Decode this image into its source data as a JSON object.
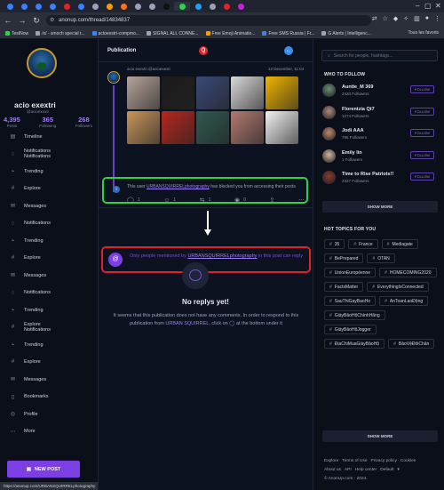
{
  "browser": {
    "url": "anonup.com/thread/14834837",
    "status_url": "https://anonup.com/URBANSQUIRRELphotography",
    "bookmarks": [
      "TestNow",
      "/x/ - smoch special t...",
      "actoexstri-compmo...",
      "SIGNAL ALL CONNE...",
      "Free Emoji Animatio...",
      "Free SMS Russia | Fr...",
      "G Alerts | Intelligenc..."
    ],
    "all_bookmarks": "Tous les favoris",
    "tab_colors": [
      "#3b82f6",
      "#3b82f6",
      "#3b82f6",
      "#3b82f6",
      "#e0222b",
      "#3b82f6",
      "#9aa3b5",
      "#f59e0b",
      "#f97316",
      "#9aa3b5",
      "#9aa3b5",
      "#111111",
      "#2fd04a",
      "#1da1f2",
      "#9aa3b5",
      "#e0222b",
      "#c026d3"
    ]
  },
  "profile": {
    "name": "acio exextri",
    "handle": "@acioexexti",
    "stats": [
      {
        "value": "4,395",
        "label": "Posts"
      },
      {
        "value": "365",
        "label": "Following"
      },
      {
        "value": "268",
        "label": "Followers"
      }
    ]
  },
  "menu": [
    {
      "icon": "timeline-icon",
      "glyph": "▤",
      "label": "Timeline"
    },
    {
      "icon": "notifications-icon",
      "glyph": "♢",
      "label": "Notifications",
      "label2": "Notifications"
    },
    {
      "icon": "trending-icon",
      "glyph": "⌁",
      "label": "Trending"
    },
    {
      "icon": "explore-icon",
      "glyph": "#",
      "label": "Explore"
    },
    {
      "icon": "messages-icon",
      "glyph": "✉",
      "label": "Messages"
    },
    {
      "icon": "notifications-icon",
      "glyph": "♢",
      "label": "Notifications"
    },
    {
      "icon": "trending-icon",
      "glyph": "⌁",
      "label": "Trending"
    },
    {
      "icon": "explore-icon",
      "glyph": "#",
      "label": "Explore"
    },
    {
      "icon": "messages-icon",
      "glyph": "✉",
      "label": "Messages"
    },
    {
      "icon": "notifications-icon",
      "glyph": "♢",
      "label": "Notifications"
    },
    {
      "icon": "trending-icon",
      "glyph": "⌁",
      "label": "Trending"
    },
    {
      "icon": "explore-icon",
      "glyph": "#",
      "label": "Explore",
      "label2": "Notifications"
    },
    {
      "icon": "trending-icon",
      "glyph": "⌁",
      "label": "Trending"
    },
    {
      "icon": "explore-icon",
      "glyph": "#",
      "label": "Explore"
    },
    {
      "icon": "messages-icon",
      "glyph": "✉",
      "label": "Messages"
    },
    {
      "icon": "bookmarks-icon",
      "glyph": "▯",
      "label": "Bookmarks"
    },
    {
      "icon": "profile-icon",
      "glyph": "◎",
      "label": "Profile"
    },
    {
      "icon": "more-icon",
      "glyph": "⋯",
      "label": "More"
    }
  ],
  "new_post_label": "NEW POST",
  "center": {
    "title": "Publication",
    "post": {
      "author": "acio exextri @acioexexti",
      "date": "12 December, 11:04",
      "actions": [
        {
          "icon": "comment-icon",
          "glyph": "◯",
          "count": "1"
        },
        {
          "icon": "like-icon",
          "glyph": "☺",
          "count": "1"
        },
        {
          "icon": "repost-icon",
          "glyph": "⇆",
          "count": "1"
        },
        {
          "icon": "views-icon",
          "glyph": "◉",
          "count": "0"
        },
        {
          "icon": "share-icon",
          "glyph": "⇪",
          "count": ""
        },
        {
          "icon": "more-icon",
          "glyph": "⋯",
          "count": ""
        }
      ],
      "thumb_colors": [
        "#b7a49a",
        "#1b1b1b",
        "#3a4a78",
        "#d9d9d9",
        "#f0b400",
        "#c9955c",
        "#b7261f",
        "#2f5a50",
        "#b07a70",
        "#f2f2f2"
      ]
    },
    "blocked": {
      "prefix": "This user ",
      "user": "URBANSQUIRRELphotography",
      "suffix": " has blocked you from accessing their posts"
    },
    "reply_only": {
      "prefix": "Only people mentioned by ",
      "user": "URBANSQUIRRELphotography",
      "suffix": " in this post can reply"
    },
    "empty": {
      "title": "No replys yet!",
      "text_a": "It seems that this publication does not have any comments. In order to respond to this publication from ",
      "user": "URBAN SQUIRREL",
      "text_b": ", click on ",
      "text_c": " at the bottom under it"
    }
  },
  "right": {
    "search_placeholder": "Search for people, hashtags...",
    "who_to_follow_title": "WHO TO FOLLOW",
    "who_to_follow": [
      {
        "name": "Auntie_M 369",
        "followers": "2420 Followers",
        "color": "#6b8f71"
      },
      {
        "name": "Florentzia Qt7",
        "followers": "1074 Followers",
        "color": "#b08a7a"
      },
      {
        "name": "Jodi AAA",
        "followers": "795 Followers",
        "color": "#c48a6a"
      },
      {
        "name": "Emily lin",
        "followers": "1 Followers",
        "color": "#d8b49a"
      },
      {
        "name": "Time to Rise Patriots!!",
        "followers": "2327 Followers",
        "color": "#8a3b2b"
      }
    ],
    "follow_label": "FOLLOW",
    "show_more": "SHOW MORE",
    "hot_topics_title": "HOT TOPICS FOR YOU",
    "topics": [
      "35",
      "France",
      "Mediagate",
      "BePrepared",
      "OTAN",
      "UnionEuropéenne",
      "HOMECOMING2020",
      "FactsMatter",
      "EverythingIsConnected",
      "SauThiGayBaoHo",
      "AnToanLaoĐộng",
      "GiàyBảoHộChínhHãng",
      "GiàyBảoHộJogger",
      "ĐịaChiMuaGiàyBảoHộ",
      "BảoVệĐôiChân"
    ],
    "footer": {
      "links1": [
        "Explore",
        "Terms of Use",
        "Privacy policy",
        "Cookies"
      ],
      "links2": [
        "About us",
        "API",
        "Help center"
      ],
      "default_label": "Default",
      "copyright": "© AnonUp.com - 2024."
    }
  }
}
